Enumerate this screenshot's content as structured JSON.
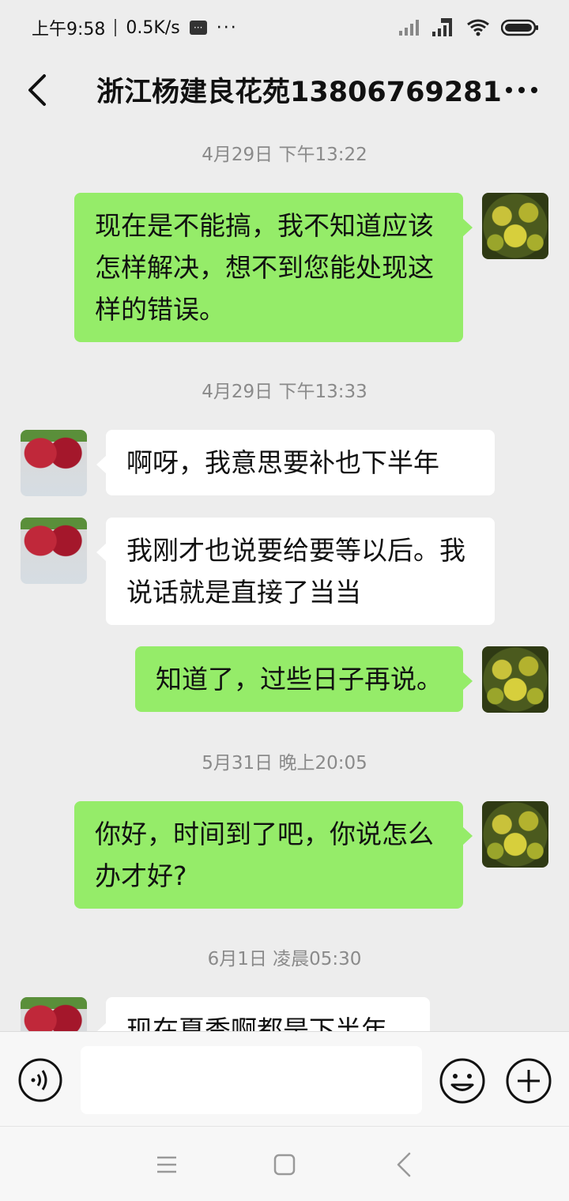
{
  "status_bar": {
    "time": "上午9:58",
    "speed": "0.5K/s",
    "more": "···"
  },
  "header": {
    "title": "浙江杨建良花苑13806769281"
  },
  "messages": [
    {
      "type": "timestamp",
      "text": "4月29日 下午13:22"
    },
    {
      "type": "sent",
      "lines": [
        "现在是不能搞，我不知道应该",
        "怎样解决，想不到您能处现这",
        "样的错误。"
      ]
    },
    {
      "type": "timestamp",
      "text": "4月29日 下午13:33"
    },
    {
      "type": "received",
      "lines": [
        "啊呀，我意思要补也下半年"
      ]
    },
    {
      "type": "received",
      "lines": [
        "我刚才也说要给要等以后。我",
        "说话就是直接了当当"
      ]
    },
    {
      "type": "sent",
      "lines": [
        "知道了，过些日子再说。"
      ]
    },
    {
      "type": "timestamp",
      "text": "5月31日 晚上20:05"
    },
    {
      "type": "sent",
      "lines": [
        "你好，时间到了吧，你说怎么",
        "办才好?"
      ]
    },
    {
      "type": "timestamp",
      "text": "6月1日 凌晨05:30"
    },
    {
      "type": "received",
      "lines": [
        "现在夏季啊都是下半年"
      ]
    }
  ],
  "input": {
    "placeholder": ""
  },
  "icons": {
    "back": "chevron-left-icon",
    "more": "more-dots-icon",
    "voice": "voice-icon",
    "emoji": "emoji-icon",
    "plus": "plus-icon"
  },
  "colors": {
    "sent_bubble": "#95ec69",
    "received_bubble": "#ffffff",
    "background": "#ededed",
    "timestamp": "#8a8a8a"
  }
}
